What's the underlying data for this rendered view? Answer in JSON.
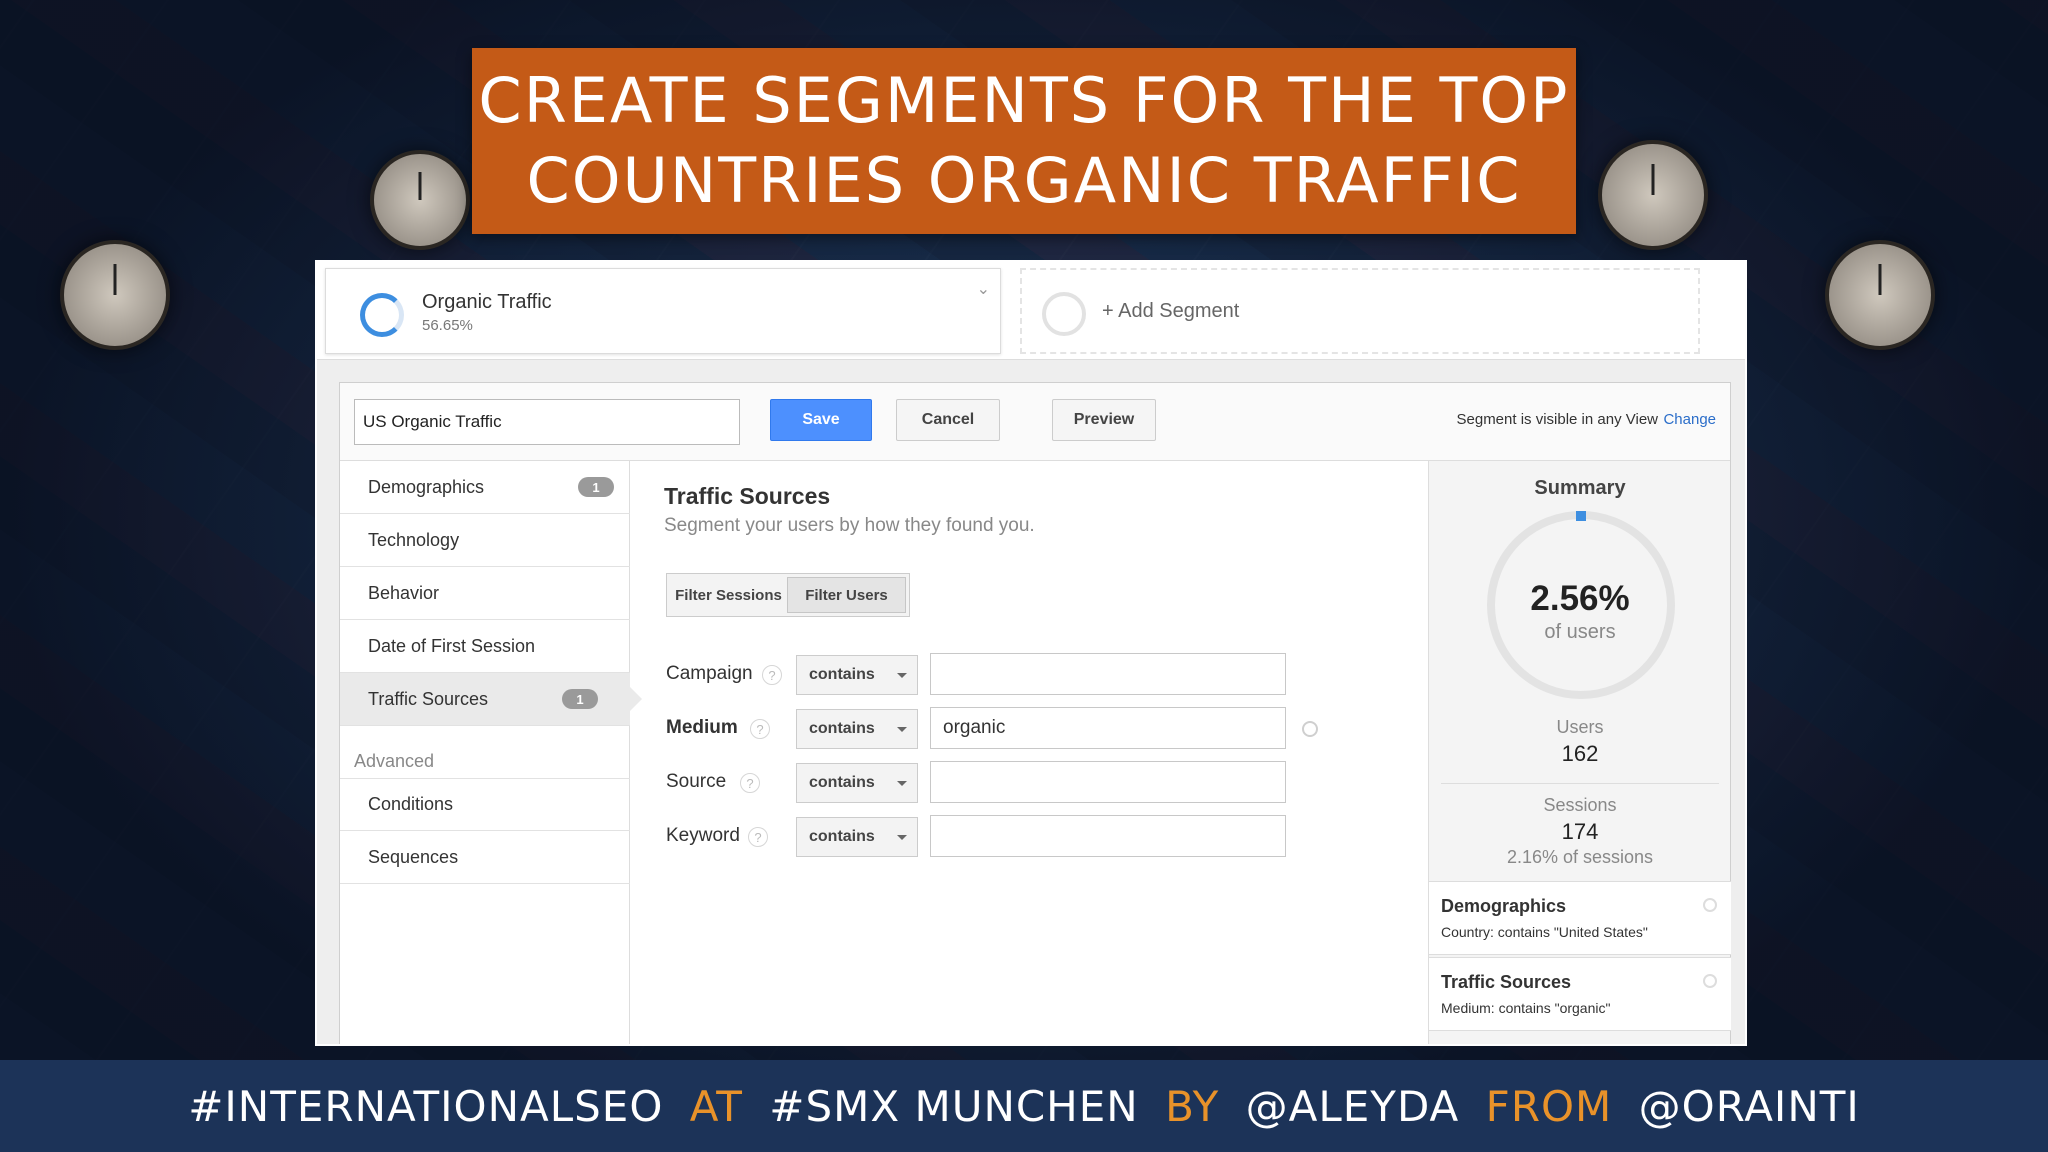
{
  "slide": {
    "title_line_1": "CREATE SEGMENTS FOR THE TOP",
    "title_line_2": "COUNTRIES ORGANIC TRAFFIC",
    "banner_color": "#c45a17",
    "footer": {
      "part1": "#INTERNATIONALSEO",
      "part2": "AT",
      "part3": "#SMX MUNCHEN",
      "part4": "BY",
      "part5": "@ALEYDA",
      "part6": "FROM",
      "part7": "@ORAINTI",
      "highlight_color": "#e8922a"
    }
  },
  "segment_bar": {
    "active_segment": {
      "name": "Organic Traffic",
      "percent": "56.65%"
    },
    "add_segment_label": "+ Add Segment"
  },
  "editor": {
    "segment_name_value": "US Organic Traffic",
    "save_label": "Save",
    "cancel_label": "Cancel",
    "preview_label": "Preview",
    "visibility_text": "Segment is visible in any View",
    "change_link": "Change",
    "nav": {
      "items": [
        {
          "label": "Demographics",
          "badge": "1"
        },
        {
          "label": "Technology"
        },
        {
          "label": "Behavior"
        },
        {
          "label": "Date of First Session"
        },
        {
          "label": "Traffic Sources",
          "badge": "1",
          "active": true
        }
      ],
      "advanced_heading": "Advanced",
      "advanced_items": [
        {
          "label": "Conditions"
        },
        {
          "label": "Sequences"
        }
      ]
    },
    "traffic_sources": {
      "title": "Traffic Sources",
      "subtitle": "Segment your users by how they found you.",
      "filter_sessions": "Filter Sessions",
      "filter_users": "Filter Users",
      "fields": [
        {
          "label": "Campaign",
          "operator": "contains",
          "value": ""
        },
        {
          "label": "Medium",
          "operator": "contains",
          "value": "organic"
        },
        {
          "label": "Source",
          "operator": "contains",
          "value": ""
        },
        {
          "label": "Keyword",
          "operator": "contains",
          "value": ""
        }
      ],
      "help_glyph": "?"
    },
    "summary": {
      "title": "Summary",
      "percent": "2.56%",
      "percent_label": "of users",
      "users_label": "Users",
      "users_value": "162",
      "sessions_label": "Sessions",
      "sessions_value": "174",
      "sessions_share": "2.16% of sessions",
      "conditions": [
        {
          "title": "Demographics",
          "detail": "Country: contains \"United States\""
        },
        {
          "title": "Traffic Sources",
          "detail": "Medium: contains \"organic\""
        }
      ]
    }
  }
}
